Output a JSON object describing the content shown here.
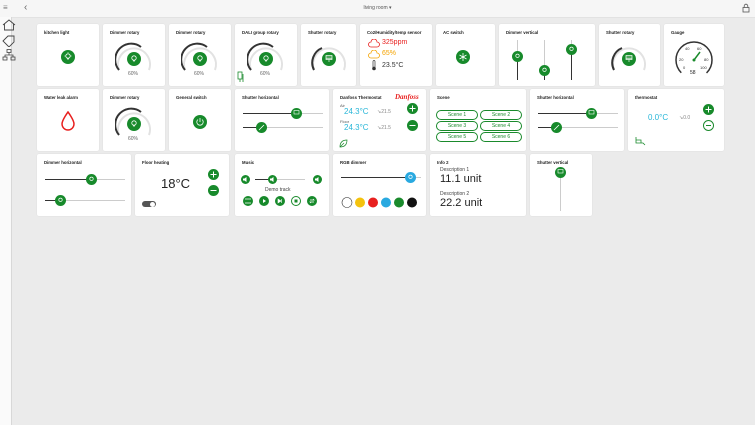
{
  "header": {
    "room_title": "living room ▾"
  },
  "cards": {
    "kitchen_light": {
      "title": "kitchen light"
    },
    "dimmer_rotary_1": {
      "title": "Dimmer rotary",
      "value": "60%",
      "level": 0.6
    },
    "dimmer_rotary_2": {
      "title": "Dimmer rotary",
      "value": "60%",
      "level": 0.6
    },
    "dali_group": {
      "title": "DALI group rotary",
      "value": "60%",
      "level": 0.6
    },
    "shutter_rotary_1": {
      "title": "Shutter rotary"
    },
    "sensor": {
      "title": "Co2/Humidity/temp sensor",
      "co2": "325ppm",
      "humidity": "65%",
      "temp": "23.5°C"
    },
    "ac_switch": {
      "title": "AC switch"
    },
    "dimmer_vertical": {
      "title": "Dimmer vertical"
    },
    "shutter_rotary_2": {
      "title": "Shutter rotary"
    },
    "gauge": {
      "title": "Gauge",
      "value": "58",
      "ticks": [
        "0",
        "20",
        "40",
        "60",
        "80",
        "100"
      ]
    },
    "water_leak": {
      "title": "Water leak alarm"
    },
    "dimmer_rotary_3": {
      "title": "Dimmer rotary",
      "value": "60%",
      "level": 0.6
    },
    "general_switch": {
      "title": "General switch"
    },
    "shutter_horizontal_1": {
      "title": "Shutter horizontal"
    },
    "danfoss": {
      "title": "Danfoss Thermostat",
      "logo": "Danfoss",
      "air_label": "Air",
      "air_temp": "24.3°C",
      "air_set": "↘21.5",
      "floor_label": "Floor",
      "floor_temp": "24.3°C",
      "floor_set": "↘21.5"
    },
    "scene": {
      "title": "Scene",
      "scenes": [
        "Scene 1",
        "Scene 2",
        "Scene 3",
        "Scene 4",
        "Scene 5",
        "Scene 6"
      ]
    },
    "shutter_horizontal_2": {
      "title": "Shutter horizontal"
    },
    "thermostat": {
      "title": "thermostat",
      "temp": "0.0°C",
      "setpoint": "↘0.0"
    },
    "dimmer_horizontal": {
      "title": "Dimmer horizontal"
    },
    "floor_heating": {
      "title": "Floor heating",
      "temp": "18°C"
    },
    "music": {
      "title": "Music",
      "track": "Demo track"
    },
    "rgb_dimmer": {
      "title": "RGB dimmer",
      "swatches": [
        "#ffffff",
        "#f4c20d",
        "#e8201f",
        "#29a9e0",
        "#1a8a2c",
        "#111111"
      ]
    },
    "info": {
      "title": "Info 2",
      "desc1": "Description 1",
      "value1": "11.1 unit",
      "desc2": "Description 2",
      "value2": "22.2 unit"
    },
    "shutter_vertical": {
      "title": "Shutter vertical"
    }
  },
  "colors": {
    "accent": "#178a2b",
    "cyan": "#29b6d8",
    "red": "#e8201f",
    "orange": "#f4a300"
  }
}
